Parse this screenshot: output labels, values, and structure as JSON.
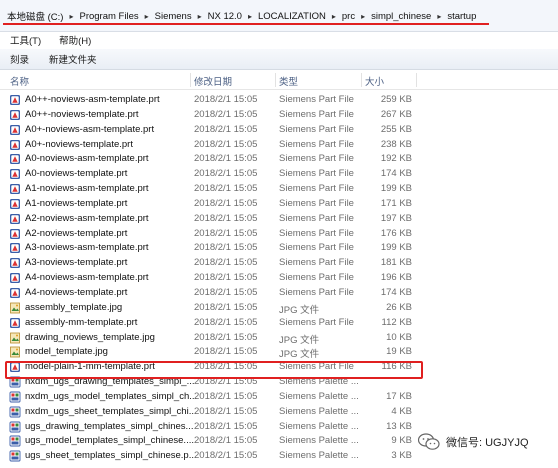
{
  "address_bar": {
    "path": [
      "本地磁盘 (C:)",
      "Program Files",
      "Siemens",
      "NX 12.0",
      "LOCALIZATION",
      "prc",
      "simpl_chinese",
      "startup"
    ],
    "separator": "▸"
  },
  "menu": [
    "工具(T)",
    "帮助(H)"
  ],
  "toolbar": [
    "刻录",
    "新建文件夹"
  ],
  "columns": {
    "name": "名称",
    "date": "修改日期",
    "type": "类型",
    "size": "大小"
  },
  "files": [
    {
      "name": "A0++-noviews-asm-template.prt",
      "date": "2018/2/1 15:05",
      "type": "Siemens Part File",
      "size": "259 KB",
      "icon": "prt-file-icon"
    },
    {
      "name": "A0++-noviews-template.prt",
      "date": "2018/2/1 15:05",
      "type": "Siemens Part File",
      "size": "267 KB",
      "icon": "prt-file-icon"
    },
    {
      "name": "A0+-noviews-asm-template.prt",
      "date": "2018/2/1 15:05",
      "type": "Siemens Part File",
      "size": "255 KB",
      "icon": "prt-file-icon"
    },
    {
      "name": "A0+-noviews-template.prt",
      "date": "2018/2/1 15:05",
      "type": "Siemens Part File",
      "size": "238 KB",
      "icon": "prt-file-icon"
    },
    {
      "name": "A0-noviews-asm-template.prt",
      "date": "2018/2/1 15:05",
      "type": "Siemens Part File",
      "size": "192 KB",
      "icon": "prt-file-icon"
    },
    {
      "name": "A0-noviews-template.prt",
      "date": "2018/2/1 15:05",
      "type": "Siemens Part File",
      "size": "174 KB",
      "icon": "prt-file-icon"
    },
    {
      "name": "A1-noviews-asm-template.prt",
      "date": "2018/2/1 15:05",
      "type": "Siemens Part File",
      "size": "199 KB",
      "icon": "prt-file-icon"
    },
    {
      "name": "A1-noviews-template.prt",
      "date": "2018/2/1 15:05",
      "type": "Siemens Part File",
      "size": "171 KB",
      "icon": "prt-file-icon"
    },
    {
      "name": "A2-noviews-asm-template.prt",
      "date": "2018/2/1 15:05",
      "type": "Siemens Part File",
      "size": "197 KB",
      "icon": "prt-file-icon"
    },
    {
      "name": "A2-noviews-template.prt",
      "date": "2018/2/1 15:05",
      "type": "Siemens Part File",
      "size": "176 KB",
      "icon": "prt-file-icon"
    },
    {
      "name": "A3-noviews-asm-template.prt",
      "date": "2018/2/1 15:05",
      "type": "Siemens Part File",
      "size": "199 KB",
      "icon": "prt-file-icon"
    },
    {
      "name": "A3-noviews-template.prt",
      "date": "2018/2/1 15:05",
      "type": "Siemens Part File",
      "size": "181 KB",
      "icon": "prt-file-icon"
    },
    {
      "name": "A4-noviews-asm-template.prt",
      "date": "2018/2/1 15:05",
      "type": "Siemens Part File",
      "size": "196 KB",
      "icon": "prt-file-icon"
    },
    {
      "name": "A4-noviews-template.prt",
      "date": "2018/2/1 15:05",
      "type": "Siemens Part File",
      "size": "174 KB",
      "icon": "prt-file-icon"
    },
    {
      "name": "assembly_template.jpg",
      "date": "2018/2/1 15:05",
      "type": "JPG 文件",
      "size": "26 KB",
      "icon": "jpg-file-icon"
    },
    {
      "name": "assembly-mm-template.prt",
      "date": "2018/2/1 15:05",
      "type": "Siemens Part File",
      "size": "112 KB",
      "icon": "prt-file-icon"
    },
    {
      "name": "drawing_noviews_template.jpg",
      "date": "2018/2/1 15:05",
      "type": "JPG 文件",
      "size": "10 KB",
      "icon": "jpg-file-icon"
    },
    {
      "name": "model_template.jpg",
      "date": "2018/2/1 15:05",
      "type": "JPG 文件",
      "size": "19 KB",
      "icon": "jpg-file-icon"
    },
    {
      "name": "model-plain-1-mm-template.prt",
      "date": "2018/2/1 15:05",
      "type": "Siemens Part File",
      "size": "116 KB",
      "icon": "prt-file-icon"
    },
    {
      "name": "nxdm_ugs_drawing_templates_simpl_...",
      "date": "2018/2/1 15:05",
      "type": "Siemens Palette ...",
      "size": "",
      "icon": "palette-file-icon"
    },
    {
      "name": "nxdm_ugs_model_templates_simpl_ch...",
      "date": "2018/2/1 15:05",
      "type": "Siemens Palette ...",
      "size": "17 KB",
      "icon": "palette-file-icon"
    },
    {
      "name": "nxdm_ugs_sheet_templates_simpl_chi...",
      "date": "2018/2/1 15:05",
      "type": "Siemens Palette ...",
      "size": "4 KB",
      "icon": "palette-file-icon"
    },
    {
      "name": "ugs_drawing_templates_simpl_chines...",
      "date": "2018/2/1 15:05",
      "type": "Siemens Palette ...",
      "size": "13 KB",
      "icon": "palette-file-icon"
    },
    {
      "name": "ugs_model_templates_simpl_chinese....",
      "date": "2018/2/1 15:05",
      "type": "Siemens Palette ...",
      "size": "9 KB",
      "icon": "palette-file-icon"
    },
    {
      "name": "ugs_sheet_templates_simpl_chinese.p...",
      "date": "2018/2/1 15:05",
      "type": "Siemens Palette ...",
      "size": "3 KB",
      "icon": "palette-file-icon"
    }
  ],
  "highlighted_file": "model-plain-1-mm-template.prt",
  "watermark": {
    "text": "微信号: UGJYJQ",
    "icon": "wechat-icon"
  },
  "colors": {
    "highlight": "#e02020",
    "header_text": "#4d6185",
    "prt_icon": "#3b5ea8",
    "jpg_icon": "#e0a020"
  }
}
